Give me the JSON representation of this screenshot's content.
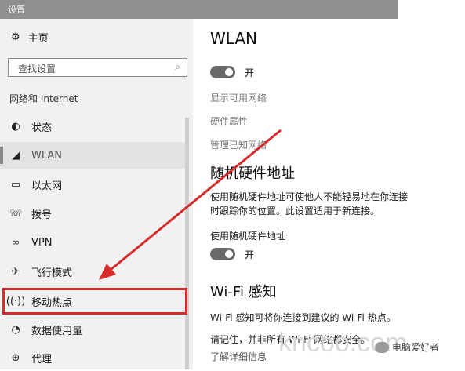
{
  "window": {
    "title": "设置"
  },
  "sidebar": {
    "home_label": "主页",
    "home_icon": "gear-icon",
    "search_placeholder": "查找设置",
    "section_title": "网络和 Internet",
    "items": [
      {
        "label": "状态",
        "icon": "globe-status-icon"
      },
      {
        "label": "WLAN",
        "icon": "wifi-icon",
        "selected": true
      },
      {
        "label": "以太网",
        "icon": "ethernet-icon"
      },
      {
        "label": "拨号",
        "icon": "dialup-icon"
      },
      {
        "label": "VPN",
        "icon": "vpn-icon"
      },
      {
        "label": "飞行模式",
        "icon": "airplane-icon"
      },
      {
        "label": "移动热点",
        "icon": "hotspot-icon",
        "highlighted": true
      },
      {
        "label": "数据使用量",
        "icon": "data-usage-icon"
      },
      {
        "label": "代理",
        "icon": "globe-proxy-icon"
      }
    ]
  },
  "main": {
    "title": "WLAN",
    "wlan_toggle_label": "开",
    "links": [
      "显示可用网络",
      "硬件属性",
      "管理已知网络"
    ],
    "random_hw": {
      "heading": "随机硬件地址",
      "description_line1": "使用随机硬件地址可使他人不能轻易地在你连接",
      "description_line2": "时跟踪你的位置。此设置适用于新连接。",
      "setting_label": "使用随机硬件地址",
      "toggle_label": "开"
    },
    "wifi_sense": {
      "heading": "Wi-Fi 感知",
      "line1": "Wi-Fi 感知可将你连接到建议的 Wi-Fi 热点。",
      "line2": "请记住，并非所有 Wi-Fi 网络都安全。",
      "link": "了解详细信息"
    }
  },
  "overlay": {
    "watermark": "kncoo.com",
    "wechat_account": "电脑爱好者",
    "annotation_color": "#d62b2b"
  }
}
